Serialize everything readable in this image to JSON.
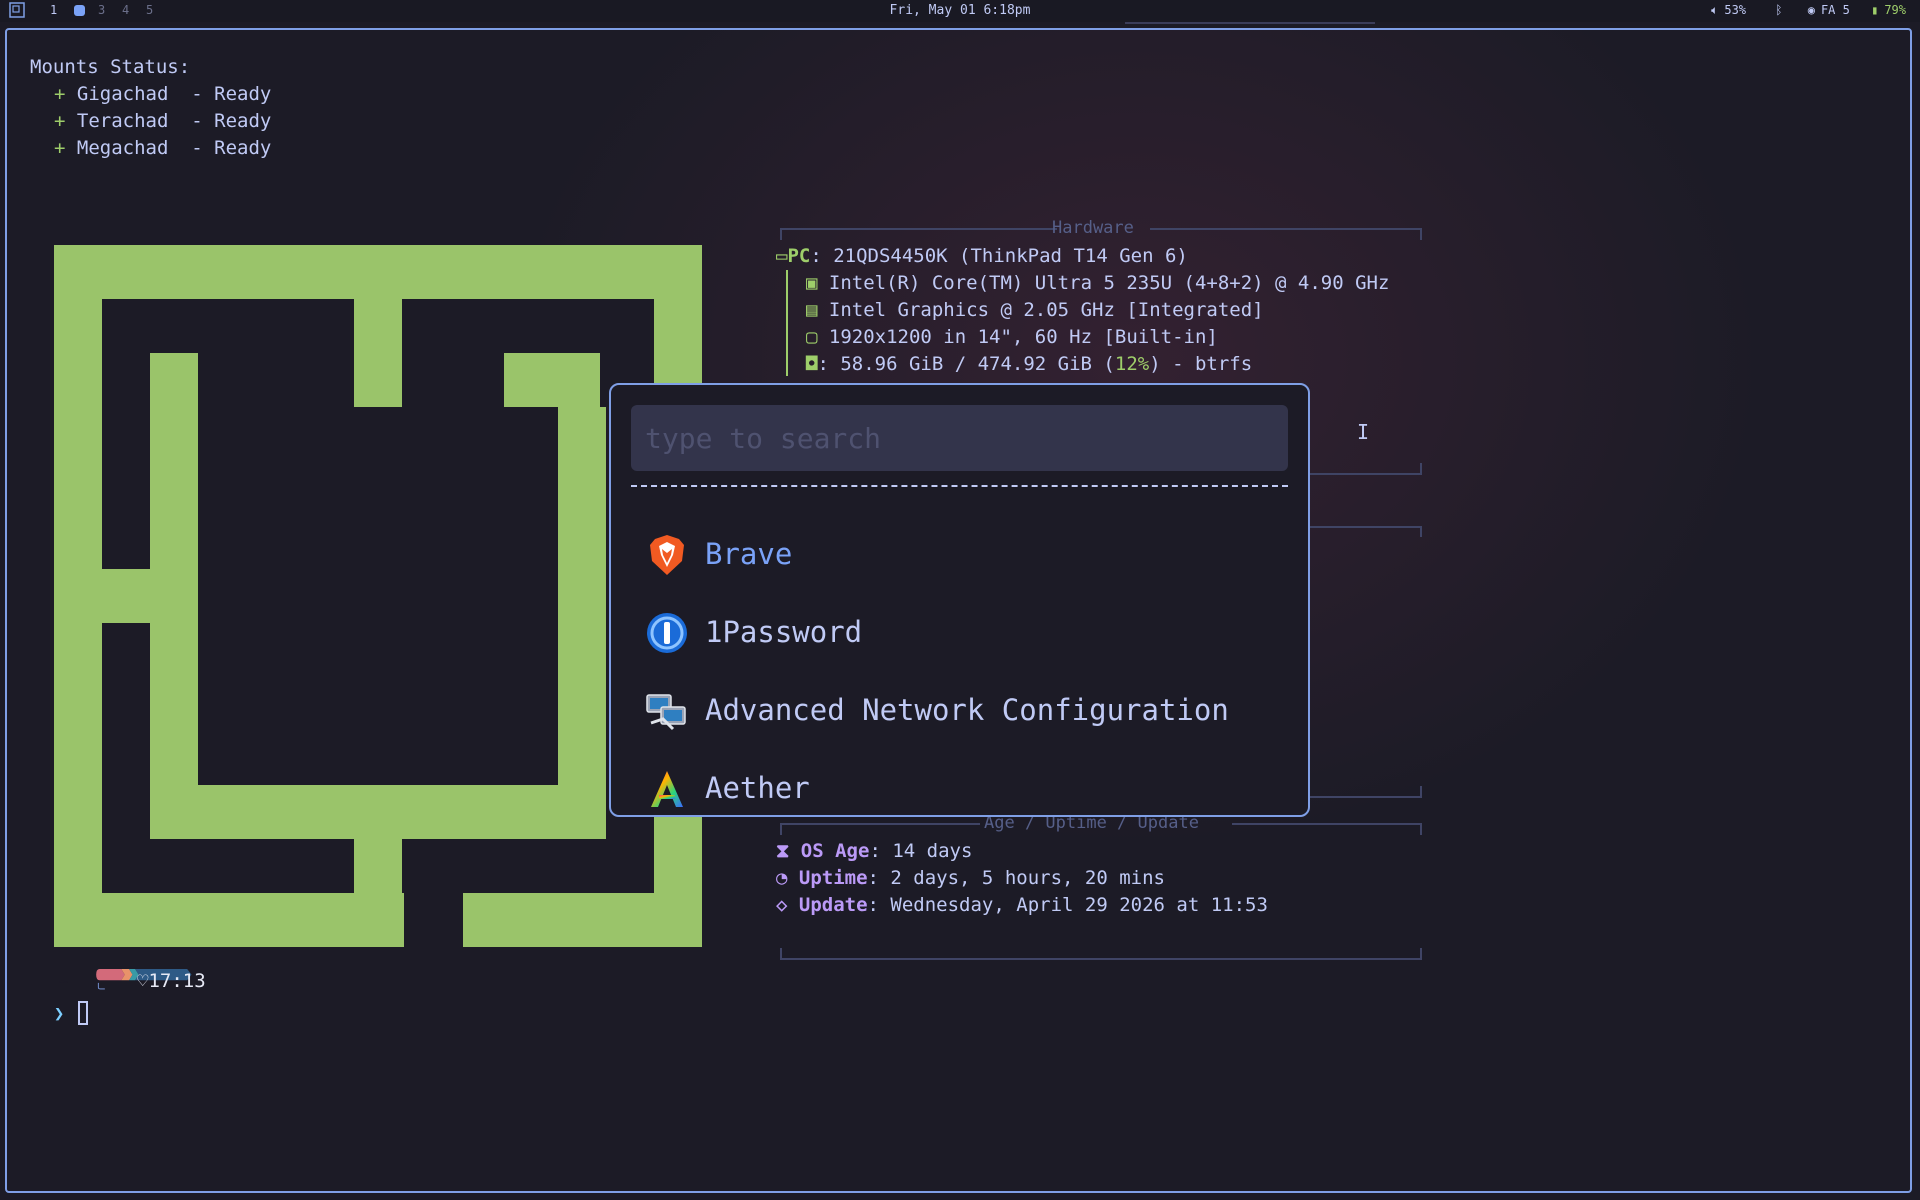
{
  "topbar": {
    "workspaces": [
      "1",
      "3",
      "4",
      "5"
    ],
    "clock": "Fri, May 01 6:18pm",
    "volume": "53%",
    "network": "FA 5",
    "battery": "79%"
  },
  "terminal": {
    "mounts": {
      "title": "Mounts Status:",
      "items": [
        {
          "bullet": "+",
          "name": "Gigachad ",
          "status": " - Ready"
        },
        {
          "bullet": "+",
          "name": "Terachad ",
          "status": " - Ready"
        },
        {
          "bullet": "+",
          "name": "Megachad ",
          "status": " - Ready"
        }
      ]
    },
    "hardware": {
      "title": "Hardware",
      "pc_label": "PC",
      "pc_value": ": 21QDS4450K (ThinkPad T14 Gen 6)",
      "cpu": "Intel(R) Core(TM) Ultra 5 235U (4+8+2) @ 4.90 GHz",
      "gpu": "Intel Graphics @ 2.05 GHz [Integrated]",
      "display": "1920x1200 in 14\", 60 Hz [Built-in]",
      "disk_pre": ": 58.96 GiB / 474.92 GiB (",
      "disk_pct": "12%",
      "disk_post": ") - btrfs"
    },
    "age": {
      "title": "Age / Uptime / Update",
      "os_age_label": "OS Age",
      "os_age_value": ": 14 days",
      "uptime_label": "Uptime",
      "uptime_value": ": 2 days, 5 hours, 20 mins",
      "update_label": "Update",
      "update_value": ": Wednesday, April 29 2026 at 11:53"
    },
    "prompt": {
      "dir": "~",
      "time": "17:13",
      "symbol": "❯"
    }
  },
  "launcher": {
    "search_placeholder": "type to search",
    "items": [
      {
        "name": "Brave",
        "icon": "brave-icon"
      },
      {
        "name": "1Password",
        "icon": "onepassword-icon"
      },
      {
        "name": "Advanced Network Configuration",
        "icon": "network-config-icon"
      },
      {
        "name": "Aether",
        "icon": "aether-icon"
      }
    ]
  },
  "colors": {
    "accent": "#7f9fe6",
    "logo_green": "#9ac46a",
    "label_purple": "#bb9af7",
    "background": "#1c1b26"
  }
}
